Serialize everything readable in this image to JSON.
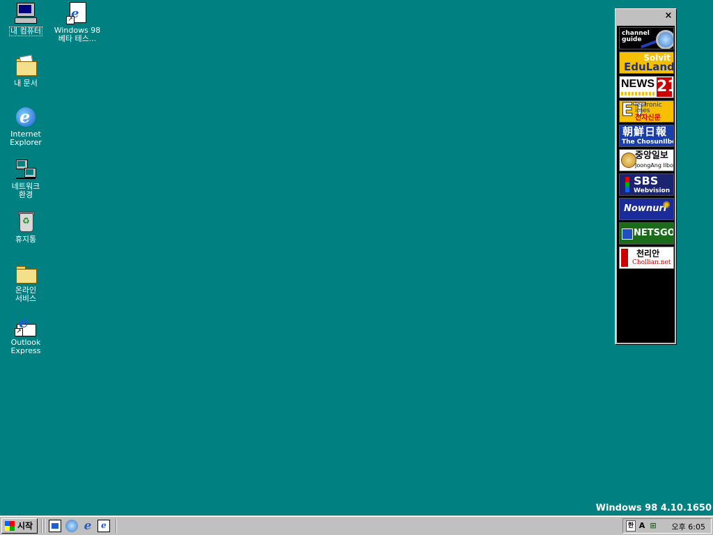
{
  "desktop": {
    "icons": [
      {
        "label": "내 컴퓨터",
        "icon": "my-computer-icon"
      },
      {
        "label": "Windows 98\n베타 테스...",
        "icon": "document-shortcut-icon"
      },
      {
        "label": "내 문서",
        "icon": "my-documents-icon"
      },
      {
        "label": "Internet\nExplorer",
        "icon": "internet-explorer-icon"
      },
      {
        "label": "네트워크\n환경",
        "icon": "network-neighborhood-icon"
      },
      {
        "label": "휴지통",
        "icon": "recycle-bin-icon"
      },
      {
        "label": "온라인\n서비스",
        "icon": "folder-icon"
      },
      {
        "label": "Outlook\nExpress",
        "icon": "outlook-express-icon"
      }
    ]
  },
  "channelbar": {
    "close": "×",
    "channels": [
      {
        "name": "channel guide",
        "line1": "channel\nguide"
      },
      {
        "name": "Solvit EduLand",
        "line1": "Solvit",
        "line2": "EduLand"
      },
      {
        "name": "NEWS 21",
        "line1": "NEWS",
        "line2": "21"
      },
      {
        "name": "Electronic Times",
        "line1": "ET",
        "line2": "lectronic\nimes",
        "line3": "전자신문"
      },
      {
        "name": "The Chosun Ilbo",
        "line1": "朝鮮日報",
        "line2": "The ChosunIlbo"
      },
      {
        "name": "JoongAng Ilbo",
        "line1": "중앙일보",
        "line2": "JoongAng Ilbo"
      },
      {
        "name": "SBS Webvision",
        "line1": "SBS",
        "line2": "Webvision"
      },
      {
        "name": "Nownuri",
        "line1": "Nownuri"
      },
      {
        "name": "NETSGO",
        "line1": "NETSGO"
      },
      {
        "name": "Chollian",
        "line1": "천리안",
        "line2": "Chollian.net"
      }
    ]
  },
  "version_text": "Windows 98 4.10.1650",
  "taskbar": {
    "start_label": "시작",
    "quicklaunch": [
      "show-desktop-icon",
      "channel-viewer-icon",
      "internet-explorer-icon",
      "outlook-express-icon"
    ],
    "tray": {
      "ime": "한",
      "a": "A",
      "clock": "오후 6:05"
    }
  },
  "colors": {
    "desktop": "#008080",
    "taskbar": "#c0c0c0",
    "channelbar_bg": "#000000"
  }
}
